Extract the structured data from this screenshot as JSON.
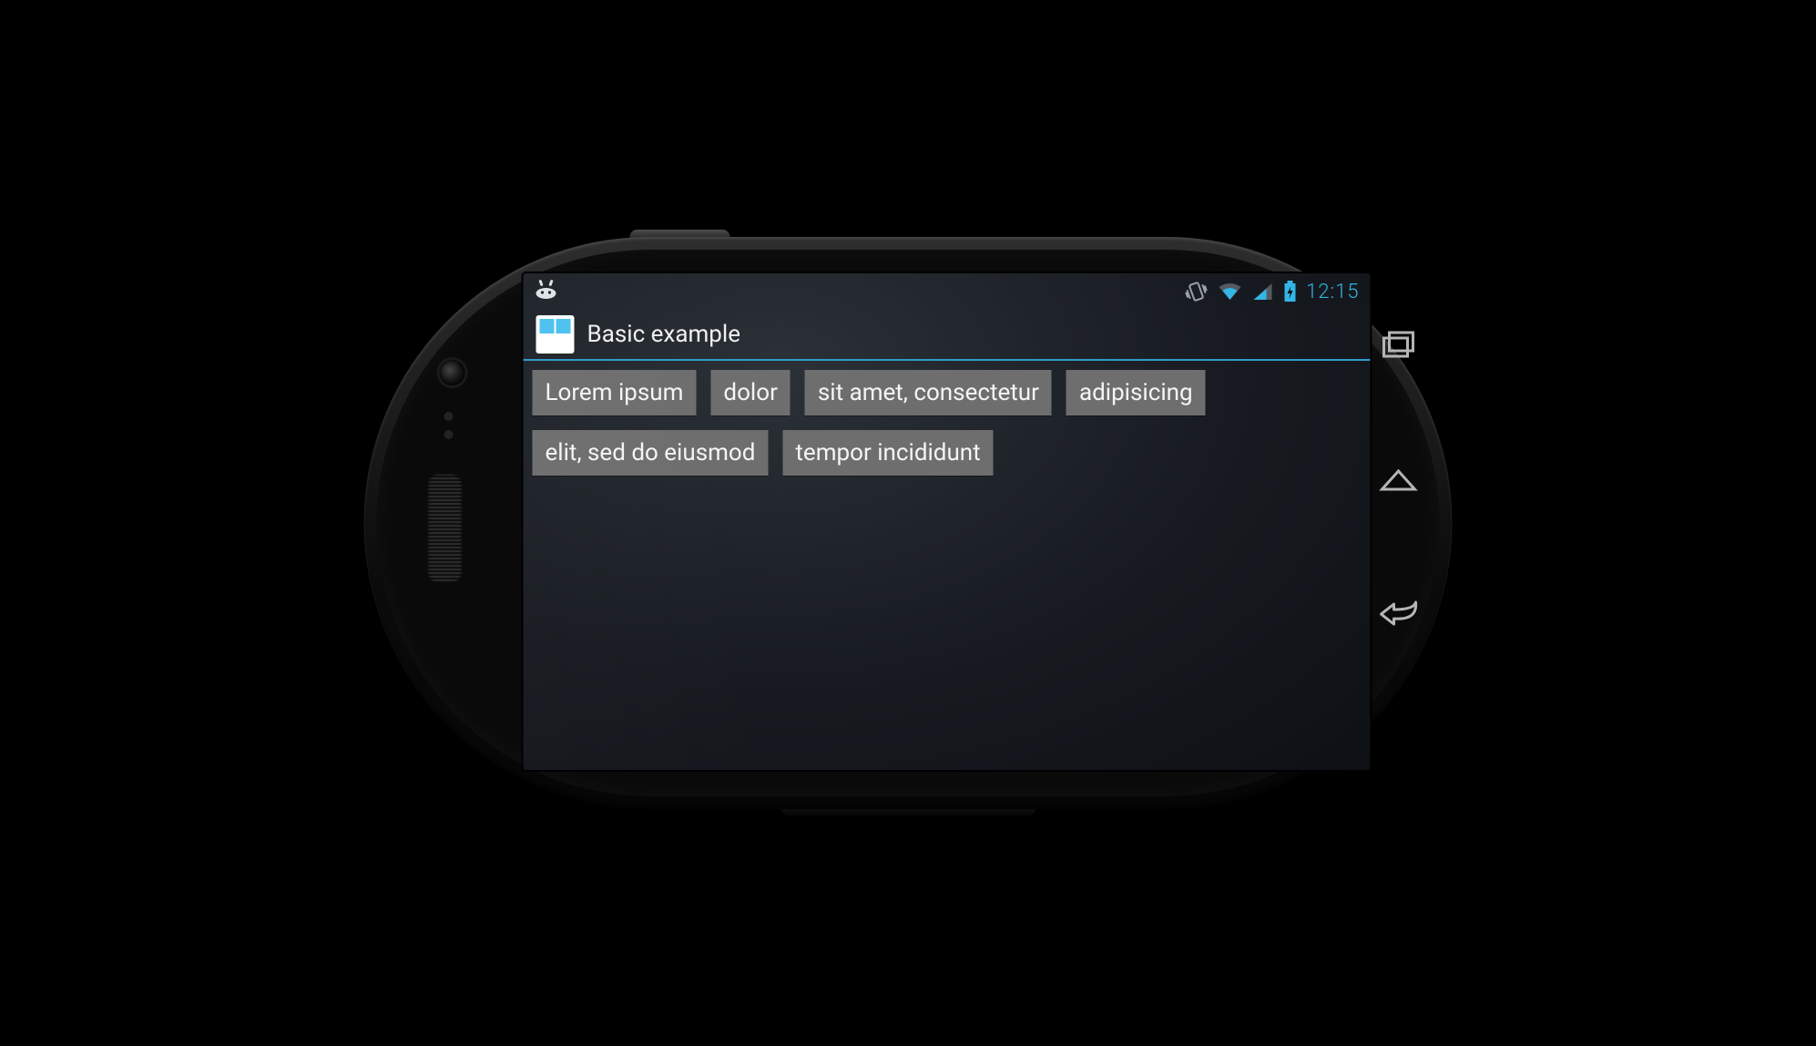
{
  "statusbar": {
    "notification_icon": "android-icon",
    "vibrate_icon": "vibrate-icon",
    "wifi_icon": "wifi-icon",
    "signal_icon": "signal-icon",
    "battery_icon": "battery-charging-icon",
    "clock": "12:15"
  },
  "actionbar": {
    "app_icon": "app-layout-icon",
    "title": "Basic example"
  },
  "chips": [
    "Lorem ipsum",
    "dolor",
    "sit amet, consectetur",
    "adipisicing",
    "elit, sed do eiusmod",
    "tempor incididunt"
  ],
  "navbar": {
    "recent": "recent-apps-icon",
    "home": "home-icon",
    "back": "back-icon"
  }
}
